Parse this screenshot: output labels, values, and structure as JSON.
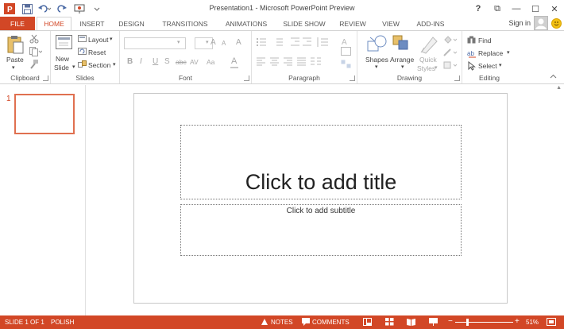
{
  "window": {
    "title": "Presentation1 - Microsoft PowerPoint Preview",
    "help": "?",
    "restore_ribbon": "⧉",
    "minimize": "—",
    "maximize": "☐",
    "close": "✕"
  },
  "account": {
    "sign_in": "Sign in"
  },
  "tabs": [
    {
      "label": "FILE"
    },
    {
      "label": "HOME"
    },
    {
      "label": "INSERT"
    },
    {
      "label": "DESIGN"
    },
    {
      "label": "TRANSITIONS"
    },
    {
      "label": "ANIMATIONS"
    },
    {
      "label": "SLIDE SHOW"
    },
    {
      "label": "REVIEW"
    },
    {
      "label": "VIEW"
    },
    {
      "label": "ADD-INS"
    }
  ],
  "ribbon": {
    "clipboard": {
      "label": "Clipboard",
      "paste": "Paste"
    },
    "slides": {
      "label": "Slides",
      "new_slide_1": "New",
      "new_slide_2": "Slide",
      "layout": "Layout",
      "reset": "Reset",
      "section": "Section"
    },
    "font": {
      "label": "Font",
      "bold": "B",
      "italic": "I",
      "underline": "U",
      "shadow": "S",
      "strike": "abc",
      "spacing": "AV",
      "case": "Aa",
      "grow": "A",
      "shrink": "A",
      "clear": "A",
      "color": "A"
    },
    "paragraph": {
      "label": "Paragraph"
    },
    "drawing": {
      "label": "Drawing",
      "shapes": "Shapes",
      "arrange": "Arrange",
      "quick_styles_1": "Quick",
      "quick_styles_2": "Styles"
    },
    "editing": {
      "label": "Editing",
      "find": "Find",
      "replace": "Replace",
      "select": "Select"
    }
  },
  "thumbnails": {
    "number": "1"
  },
  "slide": {
    "title_placeholder": "Click to add title",
    "subtitle_placeholder": "Click to add subtitle"
  },
  "status": {
    "slide_count": "SLIDE 1 OF 1",
    "language": "POLISH",
    "notes": "NOTES",
    "comments": "COMMENTS",
    "zoom": "51%",
    "zoom_minus": "−",
    "zoom_plus": "+"
  },
  "colors": {
    "accent": "#d24726",
    "thumb_border": "#e07050"
  }
}
